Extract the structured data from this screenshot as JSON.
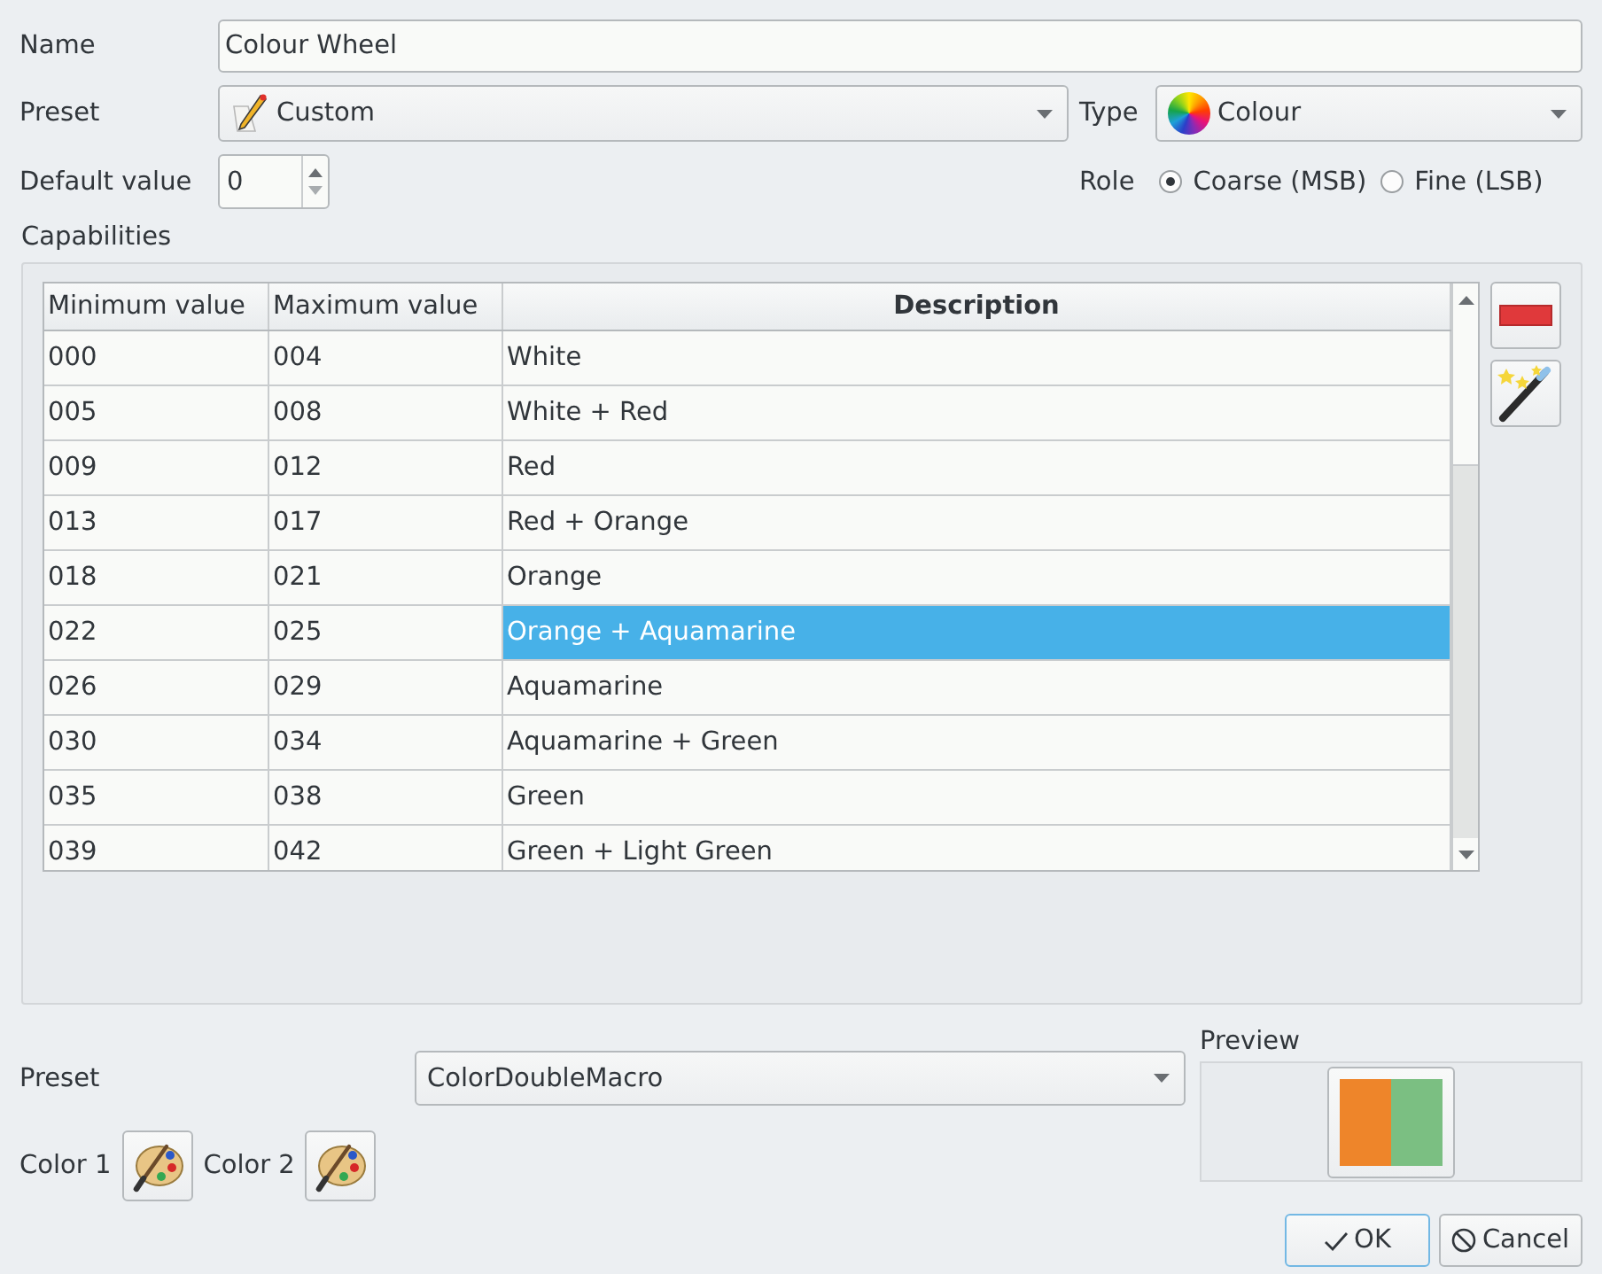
{
  "name": {
    "label": "Name",
    "value": "Colour Wheel"
  },
  "preset": {
    "label": "Preset",
    "value": "Custom"
  },
  "type": {
    "label": "Type",
    "value": "Colour"
  },
  "default_value": {
    "label": "Default value",
    "value": "0"
  },
  "role": {
    "label": "Role",
    "options": [
      {
        "label": "Coarse (MSB)",
        "selected": true
      },
      {
        "label": "Fine (LSB)",
        "selected": false
      }
    ]
  },
  "capabilities": {
    "title": "Capabilities",
    "columns": [
      {
        "label": "Minimum value",
        "selected": false
      },
      {
        "label": "Maximum value",
        "selected": false
      },
      {
        "label": "Description",
        "selected": true
      }
    ],
    "rows": [
      {
        "min": "000",
        "max": "004",
        "description": "White",
        "selected": false
      },
      {
        "min": "005",
        "max": "008",
        "description": "White + Red",
        "selected": false
      },
      {
        "min": "009",
        "max": "012",
        "description": "Red",
        "selected": false
      },
      {
        "min": "013",
        "max": "017",
        "description": "Red + Orange",
        "selected": false
      },
      {
        "min": "018",
        "max": "021",
        "description": "Orange",
        "selected": false
      },
      {
        "min": "022",
        "max": "025",
        "description": "Orange + Aquamarine",
        "selected": true
      },
      {
        "min": "026",
        "max": "029",
        "description": "Aquamarine",
        "selected": false
      },
      {
        "min": "030",
        "max": "034",
        "description": "Aquamarine + Green",
        "selected": false
      },
      {
        "min": "035",
        "max": "038",
        "description": "Green",
        "selected": false
      },
      {
        "min": "039",
        "max": "042",
        "description": "Green + Light Green",
        "selected": false
      }
    ]
  },
  "macro": {
    "preset_label": "Preset",
    "preset_value": "ColorDoubleMacro",
    "colors": [
      {
        "label": "Color 1"
      },
      {
        "label": "Color 2"
      }
    ],
    "preview": {
      "label": "Preview",
      "swatches": [
        {
          "color": "#ee852a"
        },
        {
          "color": "#7bbf82"
        }
      ]
    }
  },
  "buttons": [
    {
      "kind": "ok",
      "label": "OK"
    },
    {
      "kind": "cancel",
      "label": "Cancel"
    }
  ]
}
